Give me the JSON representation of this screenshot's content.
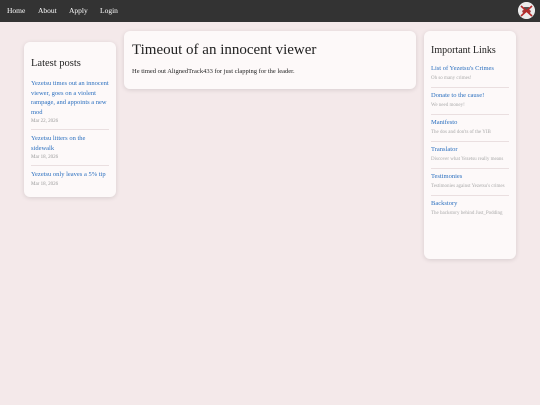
{
  "nav": {
    "items": [
      {
        "label": "Home"
      },
      {
        "label": "About"
      },
      {
        "label": "Apply"
      },
      {
        "label": "Login"
      }
    ]
  },
  "latest": {
    "title": "Latest posts",
    "posts": [
      {
        "title": "Yezetsu times out an innocent viewer, goes on a violent rampage, and appoints a new mod",
        "date": "Mar 22, 2026"
      },
      {
        "title": "Yezetsu litters on the sidewalk",
        "date": "Mar 18, 2026"
      },
      {
        "title": "Yezetsu only leaves a 5% tip",
        "date": "Mar 18, 2026"
      }
    ]
  },
  "article": {
    "title": "Timeout of an innocent viewer",
    "body": "He timed out AlignedTrack433 for just clapping for the leader."
  },
  "links": {
    "title": "Important Links",
    "items": [
      {
        "label": "List of Yezetsu's Crimes",
        "desc": "Oh so many crimes!"
      },
      {
        "label": "Donate to the cause!",
        "desc": "We need money!"
      },
      {
        "label": "Manifesto",
        "desc": "The dos and don'ts of the YIB"
      },
      {
        "label": "Translator",
        "desc": "Discover what Yezetsu really means"
      },
      {
        "label": "Testimonies",
        "desc": "Testimonies against Yezetsu's crimes"
      },
      {
        "label": "Backstory",
        "desc": "The backstory behind Just_Podding"
      }
    ]
  }
}
